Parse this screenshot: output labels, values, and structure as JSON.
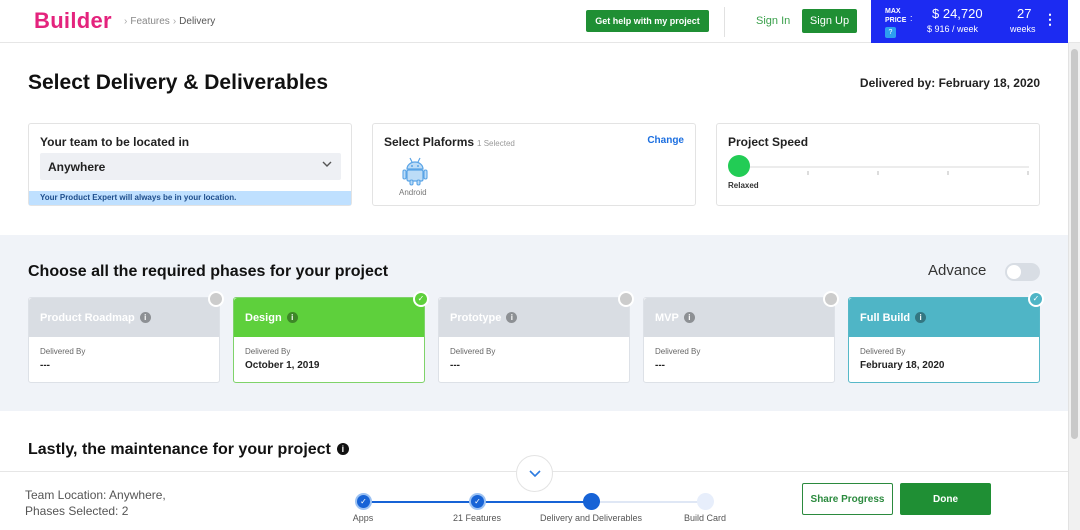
{
  "header": {
    "logo": "Builder",
    "breadcrumb": [
      "Features",
      "Delivery"
    ],
    "help_button": "Get help with my project",
    "sign_in": "Sign In",
    "sign_up": "Sign Up",
    "price_box": {
      "label_line1": "MAX",
      "label_line2": "PRICE",
      "colon": ":",
      "help_mark": "?",
      "price": "$ 24,720",
      "weekly": "$ 916 / week",
      "weeks_count": "27",
      "weeks_label": "weeks"
    },
    "brand_color": "#e4237d",
    "price_box_color": "#1c2bf2"
  },
  "page": {
    "title": "Select Delivery & Deliverables",
    "delivered_by": "Delivered by: February 18, 2020"
  },
  "location_card": {
    "title": "Your team to be located in",
    "selected": "Anywhere",
    "note": "Your Product Expert will always be in your location."
  },
  "platform_card": {
    "title": "Select Plaforms",
    "selected_count": "1 Selected",
    "change": "Change",
    "platforms": [
      {
        "name": "Android",
        "icon": "android-icon"
      }
    ]
  },
  "speed_card": {
    "title": "Project Speed",
    "current": "Relaxed",
    "level": 0
  },
  "phases": {
    "title": "Choose all the required phases for your project",
    "advance_label": "Advance",
    "advance_on": false,
    "delivered_by_label": "Delivered By",
    "items": [
      {
        "name": "Product Roadmap",
        "delivered": "---",
        "selected": false
      },
      {
        "name": "Design",
        "delivered": "October 1, 2019",
        "selected": true
      },
      {
        "name": "Prototype",
        "delivered": "---",
        "selected": false
      },
      {
        "name": "MVP",
        "delivered": "---",
        "selected": false
      },
      {
        "name": "Full Build",
        "delivered": "February 18, 2020",
        "selected": true
      }
    ]
  },
  "maintenance": {
    "title": "Lastly, the maintenance for your project"
  },
  "footer": {
    "summary_line1": "Team Location: Anywhere,",
    "summary_line2": "Phases Selected: 2",
    "steps": [
      {
        "label": "Apps",
        "state": "done"
      },
      {
        "label": "21 Features",
        "state": "done"
      },
      {
        "label": "Delivery and Deliverables",
        "state": "current"
      },
      {
        "label": "Build Card",
        "state": "todo"
      }
    ],
    "share_button": "Share Progress",
    "done_button": "Done"
  }
}
